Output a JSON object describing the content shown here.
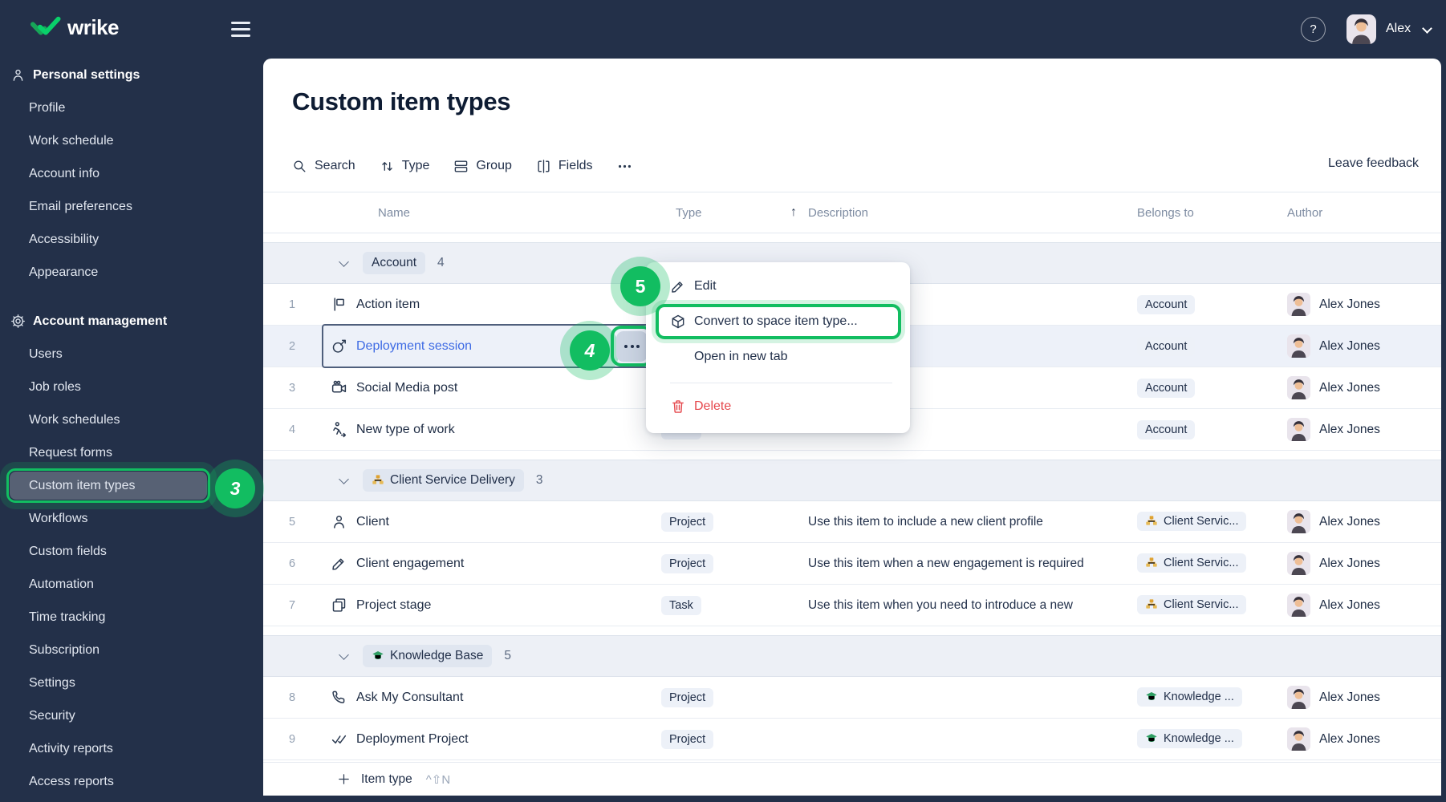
{
  "topbar": {
    "brand": "wrike",
    "user_name": "Alex",
    "help_label": "?"
  },
  "sidebar": {
    "sections": [
      {
        "label": "Personal settings",
        "icon": "person-icon",
        "items": [
          "Profile",
          "Work schedule",
          "Account info",
          "Email preferences",
          "Accessibility",
          "Appearance"
        ]
      },
      {
        "label": "Account management",
        "icon": "gear-icon",
        "items": [
          "Users",
          "Job roles",
          "Work schedules",
          "Request forms",
          "Custom item types",
          "Workflows",
          "Custom fields",
          "Automation",
          "Time tracking",
          "Subscription",
          "Settings",
          "Security",
          "Activity reports",
          "Access reports"
        ]
      }
    ],
    "active_item": "Custom item types"
  },
  "page": {
    "title": "Custom item types"
  },
  "toolbar": {
    "items": [
      {
        "label": "Search",
        "icon": "search-icon"
      },
      {
        "label": "Type",
        "icon": "sort-icon"
      },
      {
        "label": "Group",
        "icon": "group-icon"
      },
      {
        "label": "Fields",
        "icon": "fields-icon"
      },
      {
        "label": "",
        "icon": "more-icon"
      }
    ],
    "feedback_label": "Leave feedback"
  },
  "table": {
    "headers": {
      "name": "Name",
      "type": "Type",
      "description": "Description",
      "belongs": "Belongs to",
      "author": "Author",
      "sort_arrow": "↑"
    },
    "rows": [
      {
        "kind": "group",
        "label": "Account",
        "count": "4"
      },
      {
        "kind": "item",
        "num": "1",
        "name": "Action item",
        "icon": "flag-icon",
        "type": "",
        "description": "",
        "belongs": {
          "label": "Account"
        },
        "author": "Alex Jones"
      },
      {
        "kind": "item",
        "num": "2",
        "name": "Deployment session",
        "icon": "dart-icon",
        "type": "",
        "description": "",
        "belongs": {
          "label": "Account"
        },
        "author": "Alex Jones",
        "selected": true
      },
      {
        "kind": "item",
        "num": "3",
        "name": "Social Media post",
        "icon": "camera-icon",
        "type": "",
        "description": "",
        "belongs": {
          "label": "Account"
        },
        "author": "Alex Jones"
      },
      {
        "kind": "item",
        "num": "4",
        "name": "New type of work",
        "icon": "walking-person-icon",
        "type": "Task",
        "description": "",
        "belongs": {
          "label": "Account"
        },
        "author": "Alex Jones"
      },
      {
        "kind": "group",
        "label": "Client Service Delivery",
        "count": "3",
        "icon": "org-chart-icon"
      },
      {
        "kind": "item",
        "num": "5",
        "name": "Client",
        "icon": "person-icon",
        "type": "Project",
        "description": "Use this item to include a new client profile",
        "belongs": {
          "label": "Client Servic...",
          "icon": "org-chart-icon"
        },
        "author": "Alex Jones"
      },
      {
        "kind": "item",
        "num": "6",
        "name": "Client engagement",
        "icon": "pencil-icon",
        "type": "Project",
        "description": "Use this item when a new engagement is required",
        "belongs": {
          "label": "Client Servic...",
          "icon": "org-chart-icon"
        },
        "author": "Alex Jones"
      },
      {
        "kind": "item",
        "num": "7",
        "name": "Project stage",
        "icon": "pages-icon",
        "type": "Task",
        "description": "Use this item when you need to introduce a new",
        "belongs": {
          "label": "Client Servic...",
          "icon": "org-chart-icon"
        },
        "author": "Alex Jones"
      },
      {
        "kind": "group",
        "label": "Knowledge Base",
        "count": "5",
        "icon": "grad-cap-icon"
      },
      {
        "kind": "item",
        "num": "8",
        "name": "Ask My Consultant",
        "icon": "phone-icon",
        "type": "Project",
        "description": "",
        "belongs": {
          "label": "Knowledge ...",
          "icon": "grad-cap-icon"
        },
        "author": "Alex Jones"
      },
      {
        "kind": "item",
        "num": "9",
        "name": "Deployment Project",
        "icon": "double-check-icon",
        "type": "Project",
        "description": "",
        "belongs": {
          "label": "Knowledge ...",
          "icon": "grad-cap-icon"
        },
        "author": "Alex Jones"
      }
    ]
  },
  "context_menu": {
    "items": [
      {
        "label": "Edit",
        "icon": "pencil-icon"
      },
      {
        "label": "Convert to space item type...",
        "icon": "cube-icon",
        "highlighted": true
      },
      {
        "label": "Open in new tab"
      },
      {
        "divider": true
      },
      {
        "label": "Delete",
        "icon": "trash-icon",
        "danger": true
      }
    ]
  },
  "annotations": {
    "step_sidebar": "3",
    "step_more": "4",
    "step_menu": "5"
  },
  "footer": {
    "add_label": "Item type",
    "shortcut": "^⇧N"
  },
  "colors": {
    "accent_green": "#12BD61",
    "navy": "#233049",
    "danger": "#E5484D"
  }
}
